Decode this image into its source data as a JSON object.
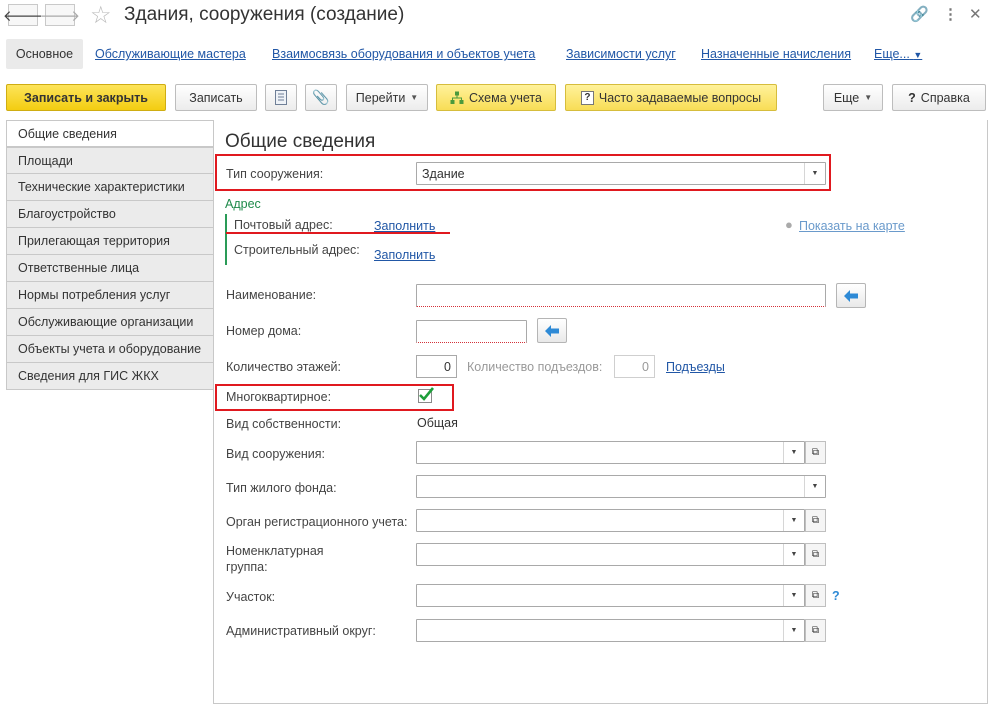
{
  "window": {
    "title": "Здания, сооружения (создание)"
  },
  "nav_tabs": [
    {
      "label": "Основное"
    },
    {
      "label": "Обслуживающие мастера"
    },
    {
      "label": "Взаимосвязь оборудования и объектов учета"
    },
    {
      "label": "Зависимости услуг"
    },
    {
      "label": "Назначенные начисления"
    },
    {
      "label": "Еще..."
    }
  ],
  "toolbar": {
    "save_close": "Записать и закрыть",
    "save": "Записать",
    "goto": "Перейти",
    "scheme": "Схема учета",
    "faq": "Часто задаваемые вопросы",
    "more": "Еще",
    "help": "Справка"
  },
  "sidebar": {
    "items": [
      {
        "label": "Общие сведения"
      },
      {
        "label": "Площади"
      },
      {
        "label": "Технические характеристики"
      },
      {
        "label": "Благоустройство"
      },
      {
        "label": "Прилегающая территория"
      },
      {
        "label": "Ответственные лица"
      },
      {
        "label": "Нормы потребления услуг"
      },
      {
        "label": "Обслуживающие организации"
      },
      {
        "label": "Объекты учета и оборудование"
      },
      {
        "label": "Сведения для ГИС ЖКХ"
      }
    ]
  },
  "form": {
    "heading": "Общие сведения",
    "structure_type": {
      "label": "Тип сооружения:",
      "value": "Здание"
    },
    "address": {
      "group_label": "Адрес",
      "postal_label": "Почтовый адрес:",
      "postal_fill": "Заполнить",
      "build_label": "Строительный адрес:",
      "build_fill": "Заполнить",
      "map_link": "Показать на карте"
    },
    "name": {
      "label": "Наименование:",
      "value": ""
    },
    "house_number": {
      "label": "Номер дома:",
      "value": ""
    },
    "floors": {
      "label": "Количество этажей:",
      "value": "0"
    },
    "entrances": {
      "label": "Количество подъездов:",
      "value": "0",
      "link": "Подъезды"
    },
    "multi_apartment": {
      "label": "Многоквартирное:",
      "checked": true
    },
    "ownership": {
      "label": "Вид собственности:",
      "value": "Общая"
    },
    "structure_kind": {
      "label": "Вид сооружения:",
      "value": ""
    },
    "housing_fund": {
      "label": "Тип жилого фонда:",
      "value": ""
    },
    "registration_body": {
      "label": "Орган регистрационного учета:",
      "value": ""
    },
    "nomenclature_group": {
      "label_line1": "Номенклатурная",
      "label_line2": "группа:",
      "value": ""
    },
    "plot": {
      "label": "Участок:",
      "value": "",
      "help": "?"
    },
    "admin_district": {
      "label": "Административный округ:",
      "value": ""
    }
  },
  "colors": {
    "accent_link": "#2157a6",
    "highlight_red": "#e0191f",
    "save_button": "#f3cd11",
    "check_green": "#1e9e3a"
  }
}
